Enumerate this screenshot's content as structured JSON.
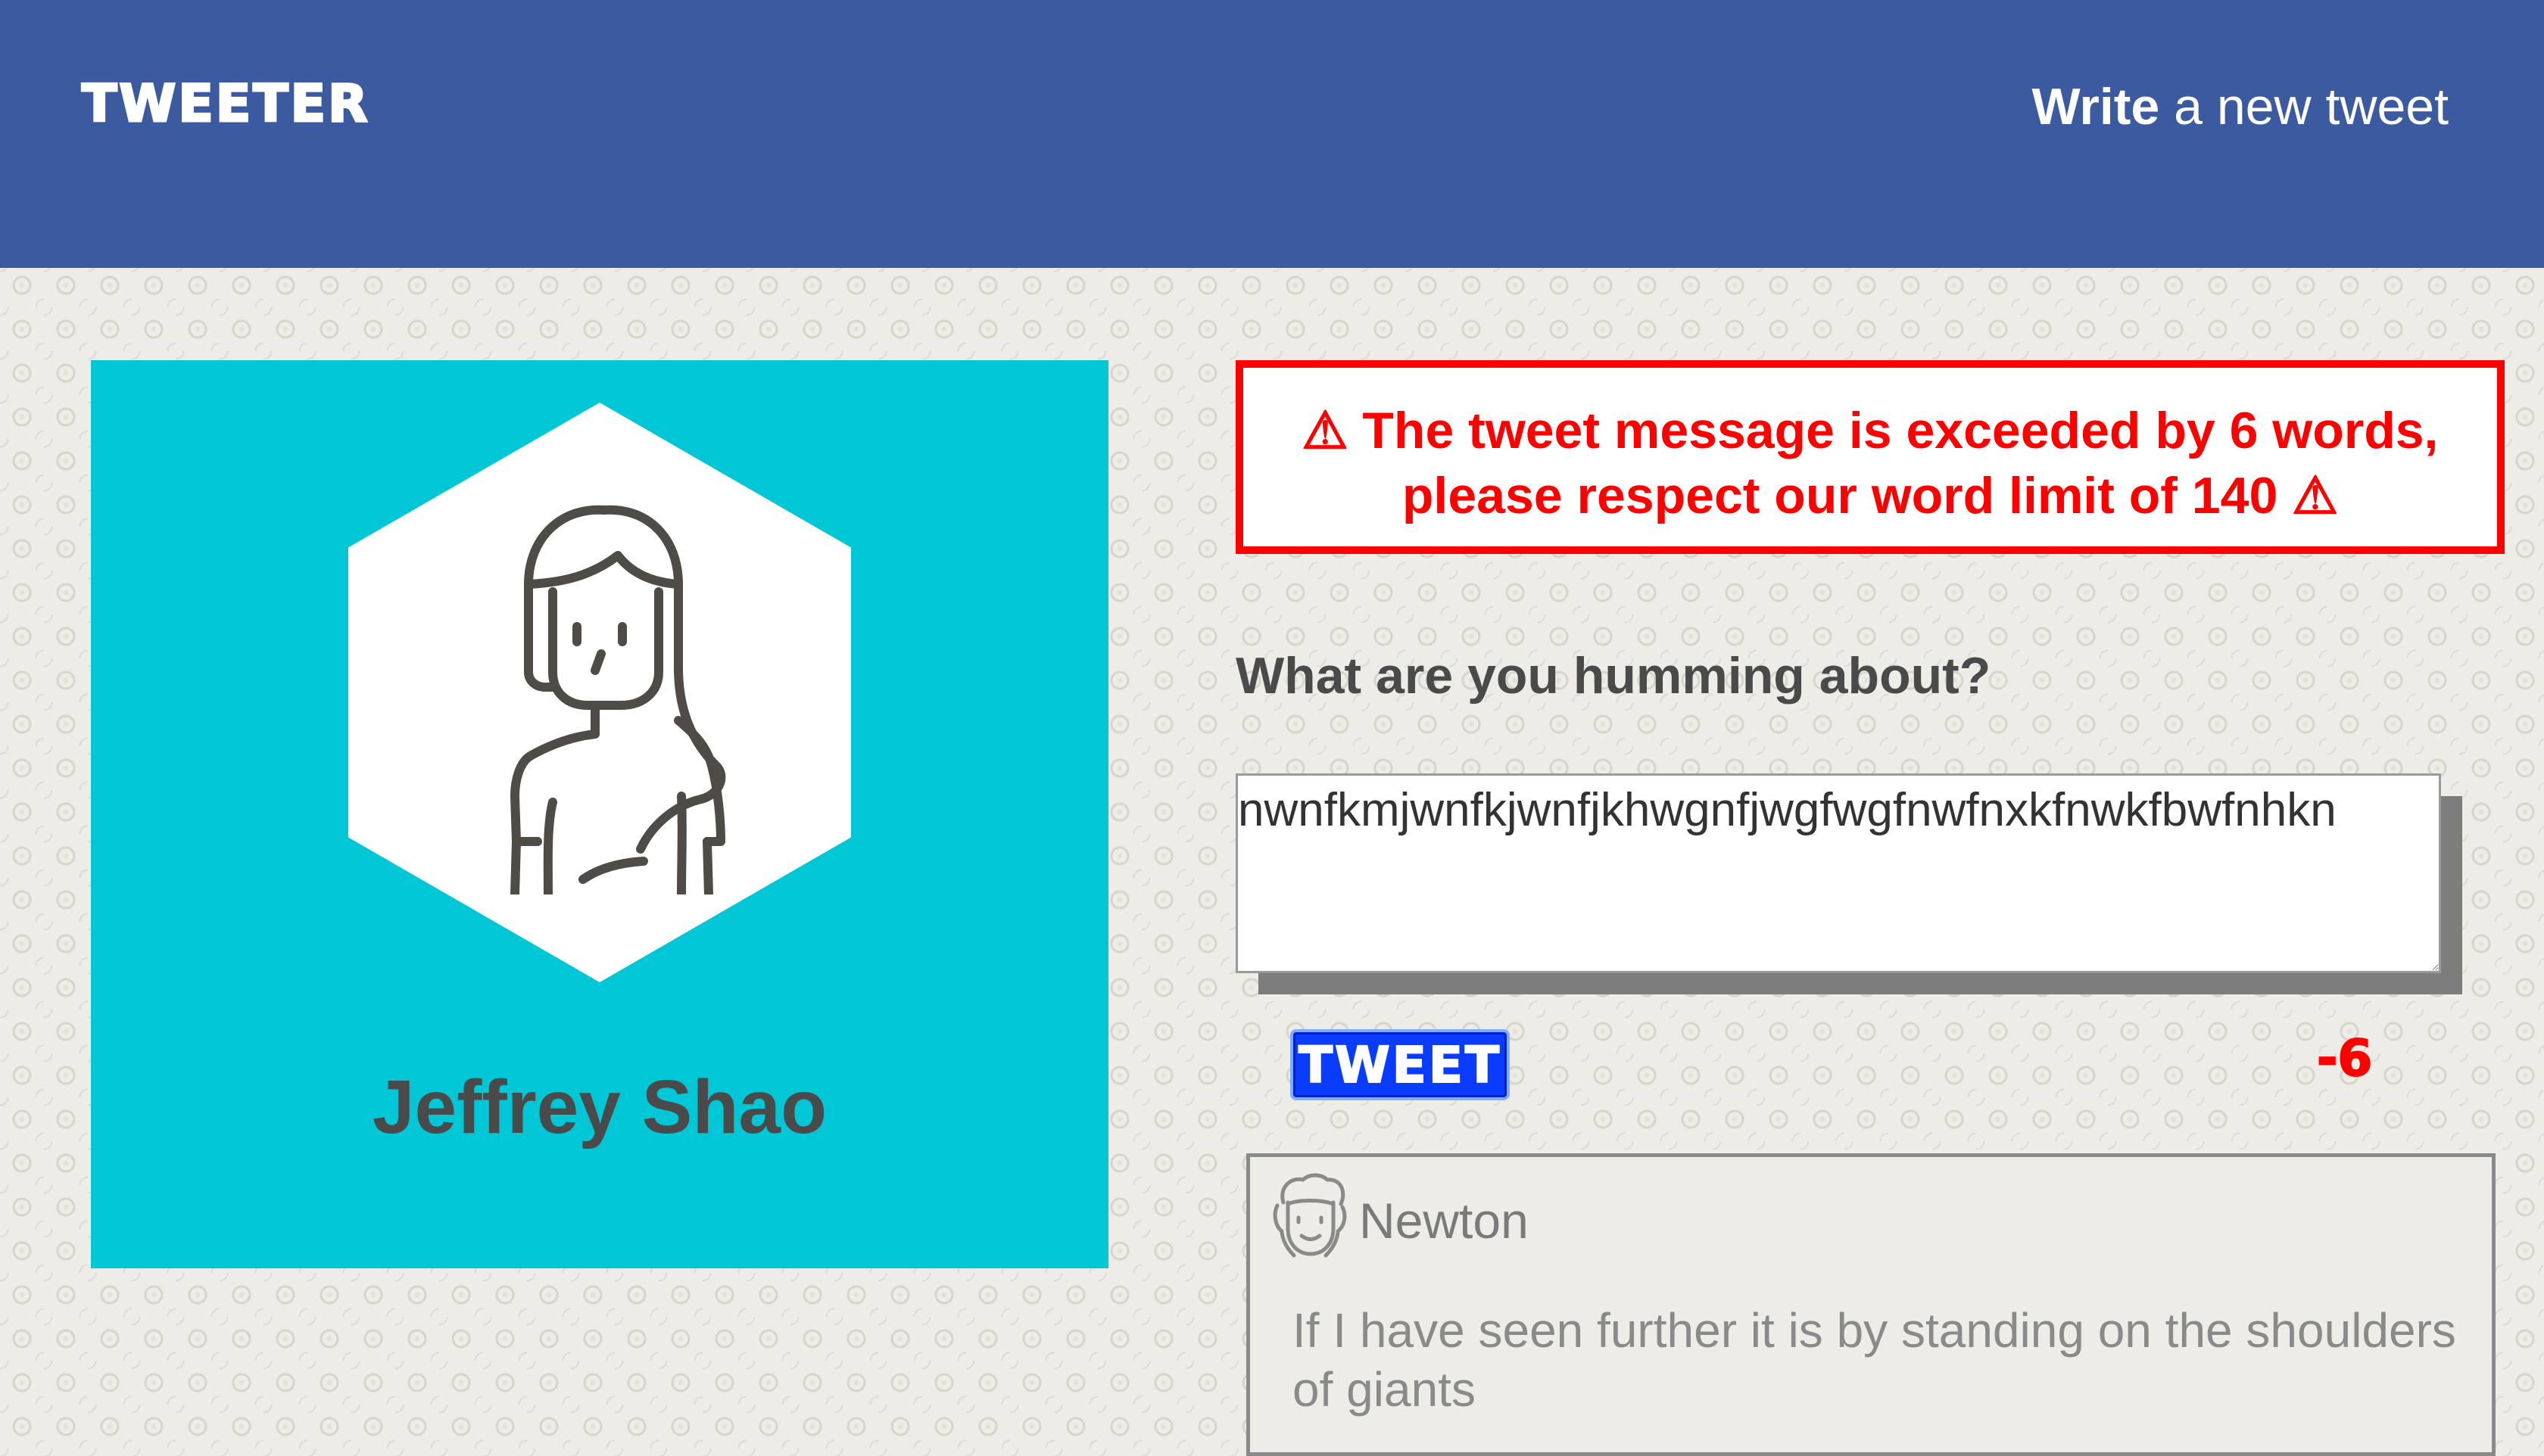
{
  "colors": {
    "header_bg": "#3b5aa0",
    "profile_bg": "#00c6d6",
    "error": "#ff0000",
    "tweet_button": "#0a3cff"
  },
  "header": {
    "logo": "TWEETER",
    "title_strong": "Write",
    "title_rest": " a new tweet"
  },
  "profile": {
    "avatar_icon": "woman-avatar-icon",
    "name": "Jeffrey Shao"
  },
  "error": {
    "icon": "warning-icon",
    "message_line1": "⚠ The tweet message is exceeded by 6 words,",
    "message_line2": "please respect our word limit of 140 ⚠"
  },
  "composer": {
    "label": "What are you humming about?",
    "value": "nwnfkmjwnfkjwnfjkhwgnfjwgfwgfnwfnxkfnwkfbwfnhkn",
    "button_label": "TWEET",
    "counter": "-6"
  },
  "feed": [
    {
      "avatar_icon": "newton-avatar-icon",
      "author": "Newton",
      "text": "If I have seen further it is by standing on the shoulders of giants"
    }
  ]
}
